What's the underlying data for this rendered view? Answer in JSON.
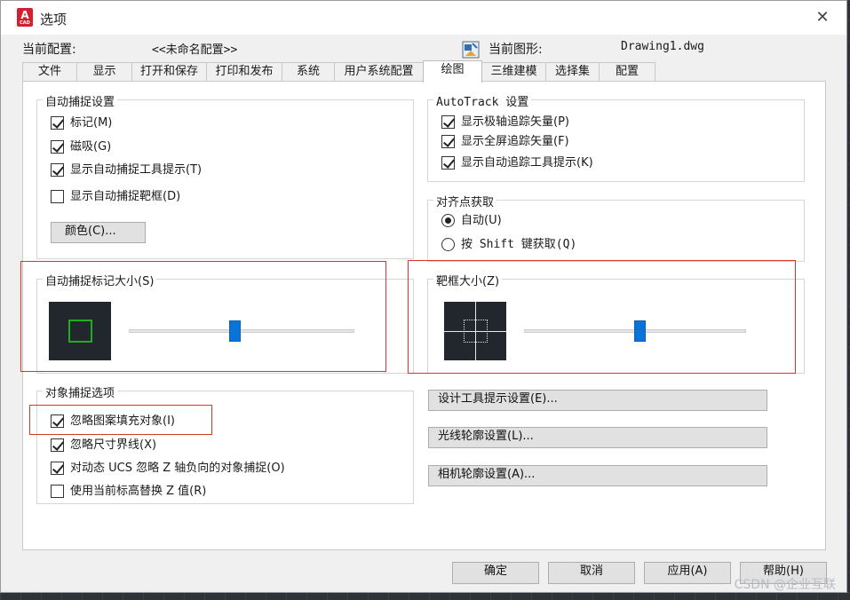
{
  "window": {
    "title": "选项",
    "app_icon_text": "A",
    "app_icon_sub": "CAD"
  },
  "profile": {
    "current_config_label": "当前配置:",
    "current_config_value": "<<未命名配置>>",
    "current_drawing_label": "当前图形:",
    "current_drawing_value": "Drawing1.dwg"
  },
  "tabs": [
    "文件",
    "显示",
    "打开和保存",
    "打印和发布",
    "系统",
    "用户系统配置",
    "绘图",
    "三维建模",
    "选择集",
    "配置"
  ],
  "active_tab": "绘图",
  "autosnap": {
    "title": "自动捕捉设置",
    "marker": {
      "label": "标记(M)",
      "checked": true
    },
    "magnet": {
      "label": "磁吸(G)",
      "checked": true
    },
    "tooltip": {
      "label": "显示自动捕捉工具提示(T)",
      "checked": true
    },
    "aperture": {
      "label": "显示自动捕捉靶框(D)",
      "checked": false
    },
    "color_button": "颜色(C)..."
  },
  "autotrack": {
    "title": "AutoTrack 设置",
    "polar": {
      "label": "显示极轴追踪矢量(P)",
      "checked": true
    },
    "fullscreen": {
      "label": "显示全屏追踪矢量(F)",
      "checked": true
    },
    "tooltip": {
      "label": "显示自动追踪工具提示(K)",
      "checked": true
    }
  },
  "alignment": {
    "title": "对齐点获取",
    "auto": {
      "label": "自动(U)",
      "selected": true
    },
    "shift": {
      "label": "按 Shift 键获取(Q)",
      "selected": false
    }
  },
  "marker_size": {
    "title": "自动捕捉标记大小(S)",
    "level": 0.47
  },
  "aperture_size": {
    "title": "靶框大小(Z)",
    "level": 0.52
  },
  "osnap": {
    "title": "对象捕捉选项",
    "ignore_hatch": {
      "label": "忽略图案填充对象(I)",
      "checked": true
    },
    "ignore_dim": {
      "label": "忽略尺寸界线(X)",
      "checked": true
    },
    "ignore_negz": {
      "label": "对动态 UCS 忽略 Z 轴负向的对象捕捉(O)",
      "checked": true
    },
    "replace_z": {
      "label": "使用当前标高替换 Z 值(R)",
      "checked": false
    }
  },
  "side_buttons": {
    "design_tooltip": "设计工具提示设置(E)...",
    "light_glyph": "光线轮廓设置(L)...",
    "camera_glyph": "相机轮廓设置(A)..."
  },
  "footer": {
    "ok": "确定",
    "cancel": "取消",
    "apply": "应用(A)",
    "help": "帮助(H)"
  },
  "watermark": "CSDN @企业互联",
  "colors": {
    "highlight_box": "#d6372c",
    "slider_thumb": "#0a74d6",
    "marker_green": "#1fae1f"
  }
}
